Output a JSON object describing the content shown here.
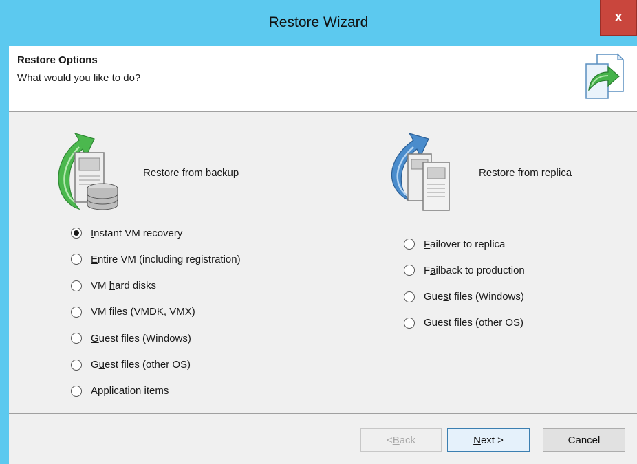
{
  "window": {
    "title": "Restore Wizard",
    "close_label": "x"
  },
  "header": {
    "title": "Restore Options",
    "subtitle": "What would you like to do?",
    "icon": "document-restore-arrow-icon"
  },
  "backup_group": {
    "label": "Restore from backup",
    "icon": "server-database-green-arrow-icon",
    "options": [
      {
        "pre": "",
        "accel": "I",
        "post": "nstant VM recovery",
        "checked": true
      },
      {
        "pre": "",
        "accel": "E",
        "post": "ntire VM (including registration)",
        "checked": false
      },
      {
        "pre": "VM ",
        "accel": "h",
        "post": "ard disks",
        "checked": false
      },
      {
        "pre": "",
        "accel": "V",
        "post": "M files (VMDK, VMX)",
        "checked": false
      },
      {
        "pre": "",
        "accel": "G",
        "post": "uest files (Windows)",
        "checked": false
      },
      {
        "pre": "G",
        "accel": "u",
        "post": "est files (other OS)",
        "checked": false
      },
      {
        "pre": "A",
        "accel": "p",
        "post": "plication items",
        "checked": false
      }
    ]
  },
  "replica_group": {
    "label": "Restore from replica",
    "icon": "servers-blue-arrow-icon",
    "options": [
      {
        "pre": "",
        "accel": "F",
        "post": "ailover to replica",
        "checked": false
      },
      {
        "pre": "F",
        "accel": "a",
        "post": "ilback to production",
        "checked": false
      },
      {
        "pre": "Gue",
        "accel": "s",
        "post": "t files (Windows)",
        "checked": false
      },
      {
        "pre": "Gue",
        "accel": "s",
        "post": "t files (other OS)",
        "checked": false
      }
    ]
  },
  "footer": {
    "back": {
      "pre": "< ",
      "accel": "B",
      "post": "ack",
      "enabled": false
    },
    "next": {
      "pre": "",
      "accel": "N",
      "post": "ext >",
      "enabled": true
    },
    "cancel": {
      "label": "Cancel",
      "enabled": true
    }
  }
}
